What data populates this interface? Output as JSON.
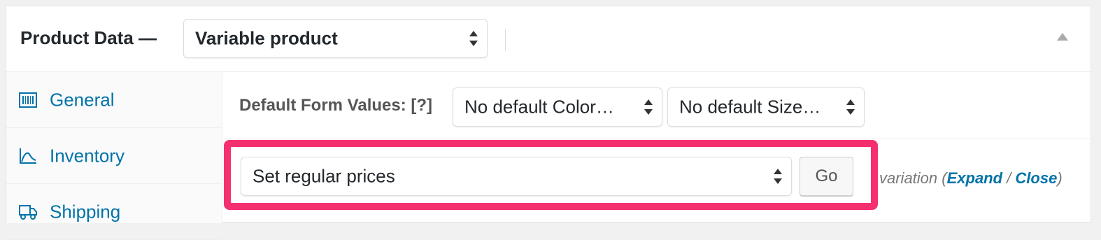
{
  "header": {
    "title": "Product Data —",
    "product_type": {
      "selected": "Variable product"
    }
  },
  "tabs": [
    {
      "label": "General",
      "icon": "barcode-icon"
    },
    {
      "label": "Inventory",
      "icon": "chart-icon"
    },
    {
      "label": "Shipping",
      "icon": "truck-icon"
    }
  ],
  "default_form_values": {
    "label": "Default Form Values:",
    "help": "[?]",
    "color": {
      "selected": "No default Color…"
    },
    "size": {
      "selected": "No default Size…"
    }
  },
  "bulk_actions": {
    "selected": "Set regular prices",
    "go_label": "Go",
    "highlight_color": "#f5306f"
  },
  "variation_controls": {
    "text": "variation (",
    "expand": "Expand",
    "separator": " / ",
    "close": "Close",
    "end": ")"
  },
  "colors": {
    "link": "#0073aa",
    "text": "#23282d",
    "highlight": "#f5306f"
  }
}
